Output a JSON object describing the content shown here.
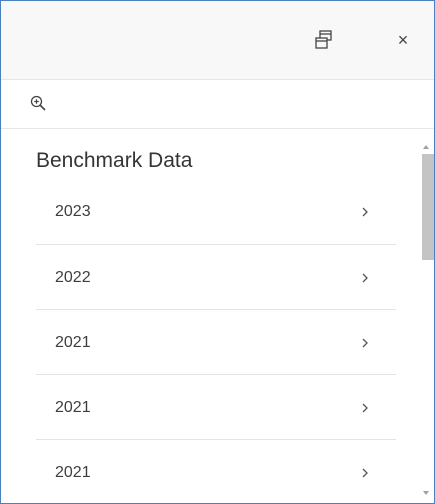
{
  "header": {
    "dock_icon": "dock-window-icon",
    "close_label": "×"
  },
  "toolbar": {
    "zoom_icon": "zoom-in-icon"
  },
  "section": {
    "title": "Benchmark Data",
    "items": [
      {
        "label": "2023",
        "icon": "chevron-right-icon"
      },
      {
        "label": "2022",
        "icon": "chevron-right-icon"
      },
      {
        "label": "2021",
        "icon": "chevron-right-icon"
      },
      {
        "label": "2021",
        "icon": "chevron-right-icon"
      },
      {
        "label": "2021",
        "icon": "chevron-right-icon"
      }
    ]
  },
  "colors": {
    "border": "#4a7fc1",
    "header_bg": "#f8f8f8",
    "text": "#353535"
  }
}
